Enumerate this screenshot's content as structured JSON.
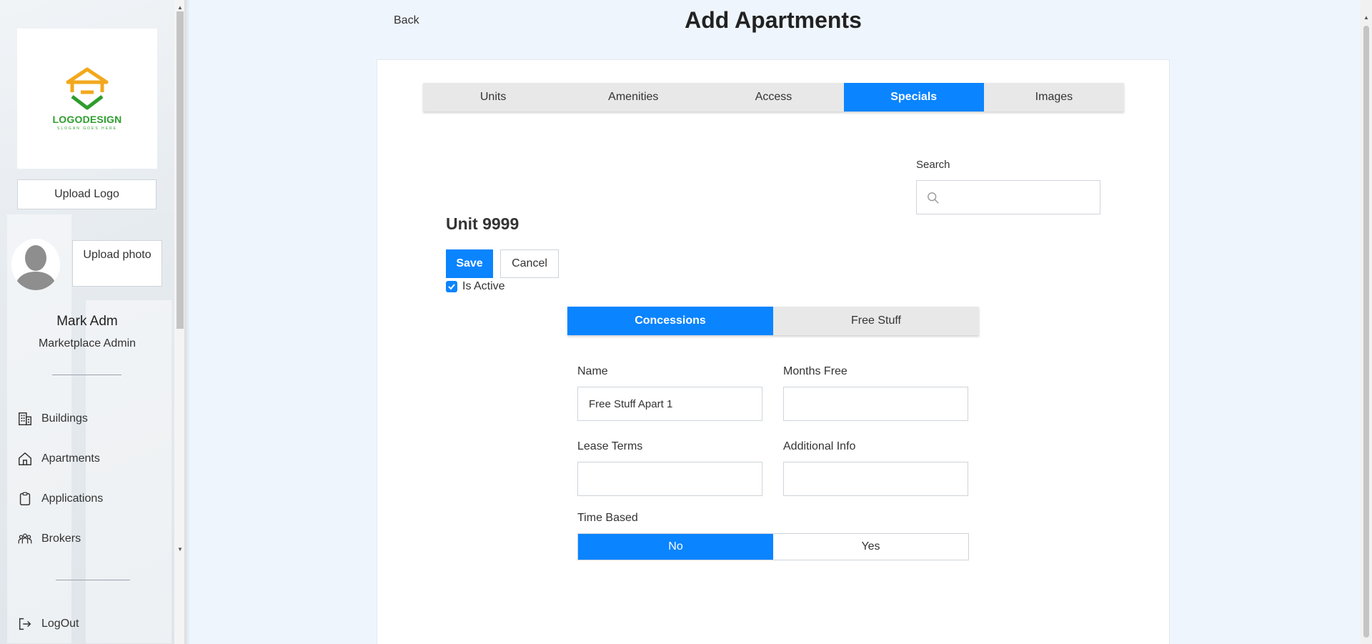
{
  "page": {
    "title": "Add Apartments",
    "back_label": "Back"
  },
  "sidebar": {
    "logo_text": "LOGODESIGN",
    "logo_sub": "SLOGAN GOES HERE",
    "upload_logo": "Upload Logo",
    "upload_photo": "Upload photo",
    "user_name": "Mark Adm",
    "user_role": "Marketplace Admin",
    "items": [
      {
        "label": "Buildings",
        "icon": "buildings-icon"
      },
      {
        "label": "Apartments",
        "icon": "home-icon"
      },
      {
        "label": "Applications",
        "icon": "clipboard-icon"
      },
      {
        "label": "Brokers",
        "icon": "people-icon"
      }
    ],
    "logout": "LogOut"
  },
  "tabs": [
    {
      "label": "Units",
      "active": false
    },
    {
      "label": "Amenities",
      "active": false
    },
    {
      "label": "Access",
      "active": false
    },
    {
      "label": "Specials",
      "active": true
    },
    {
      "label": "Images",
      "active": false
    }
  ],
  "search": {
    "label": "Search",
    "value": "",
    "placeholder": ""
  },
  "unit": {
    "title": "Unit 9999",
    "save": "Save",
    "cancel": "Cancel",
    "is_active_label": "Is Active",
    "is_active": true
  },
  "subtabs": [
    {
      "label": "Concessions",
      "active": true
    },
    {
      "label": "Free Stuff",
      "active": false
    }
  ],
  "form": {
    "name_label": "Name",
    "name_value": "Free Stuff Apart 1",
    "months_free_label": "Months Free",
    "months_free_value": "",
    "lease_terms_label": "Lease Terms",
    "lease_terms_value": "",
    "additional_info_label": "Additional Info",
    "additional_info_value": "",
    "time_based_label": "Time Based",
    "time_based_options": [
      "No",
      "Yes"
    ],
    "time_based_selected": "No"
  },
  "colors": {
    "accent": "#0a84ff",
    "logo_orange": "#f2a81d",
    "logo_green": "#2e9d2e"
  }
}
